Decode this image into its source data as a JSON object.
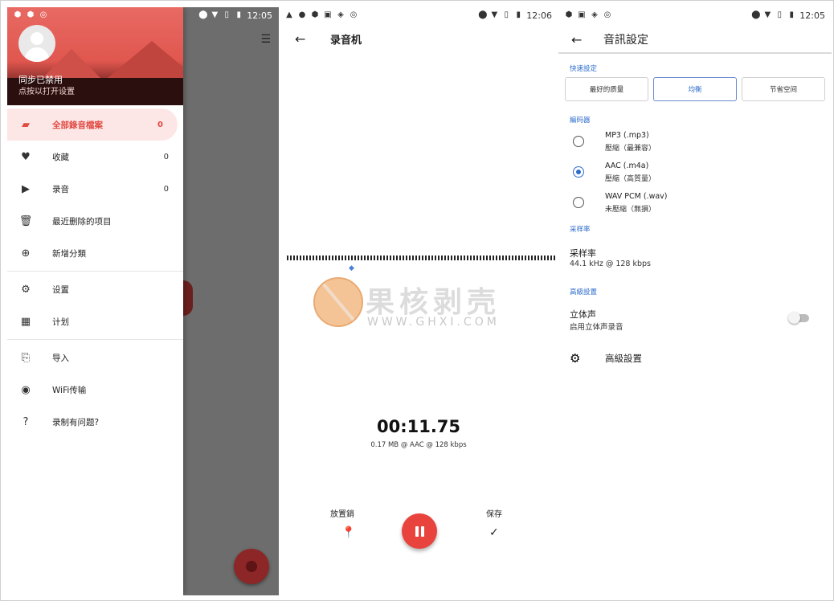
{
  "screen1": {
    "status": {
      "time": "12:05"
    },
    "header": {
      "sync_title": "同步已禁用",
      "sync_sub": "点按以打开设置"
    },
    "menu": [
      {
        "label": "全部錄音檔案",
        "count": "0",
        "icon": "folder-icon"
      },
      {
        "label": "收藏",
        "count": "0",
        "icon": "heart-icon"
      },
      {
        "label": "录音",
        "count": "0",
        "icon": "label-icon"
      },
      {
        "label": "最近删除的项目",
        "icon": "trash-icon"
      },
      {
        "label": "新增分類",
        "icon": "add-circle-icon"
      },
      {
        "label": "设置",
        "icon": "gear-icon"
      },
      {
        "label": "计划",
        "icon": "schedule-icon"
      },
      {
        "label": "导入",
        "icon": "import-icon"
      },
      {
        "label": "WiFi传输",
        "icon": "wifi-transfer-icon"
      },
      {
        "label": "录制有问题?",
        "icon": "help-icon"
      }
    ]
  },
  "screen2": {
    "status": {
      "time": "12:06"
    },
    "title": "录音机",
    "watermark": {
      "text": "果核剥壳",
      "url": "WWW.GHXI.COM"
    },
    "timer": "00:11.75",
    "info": "0.17 MB @ AAC @ 128 kbps",
    "discard_label": "放置銷",
    "save_label": "保存"
  },
  "screen3": {
    "status": {
      "time": "12:05"
    },
    "title": "音訊設定",
    "quick_section": "快速設定",
    "quick_options": [
      "最好的质量",
      "均衡",
      "节省空间"
    ],
    "quick_selected": 1,
    "encoder_section": "編码器",
    "encoders": [
      {
        "title": "MP3 (.mp3)",
        "sub": "壓縮（最兼容）",
        "selected": false
      },
      {
        "title": "AAC (.m4a)",
        "sub": "壓縮（高質量）",
        "selected": true
      },
      {
        "title": "WAV PCM (.wav)",
        "sub": "未壓縮（無損）",
        "selected": false
      }
    ],
    "samplerate_section": "采样率",
    "samplerate_title": "采样率",
    "samplerate_value": "44.1 kHz @ 128 kbps",
    "advanced_section": "高級設置",
    "stereo_title": "立体声",
    "stereo_sub": "启用立体声录音",
    "stereo_enabled": false,
    "advanced_title": "高級設置"
  }
}
